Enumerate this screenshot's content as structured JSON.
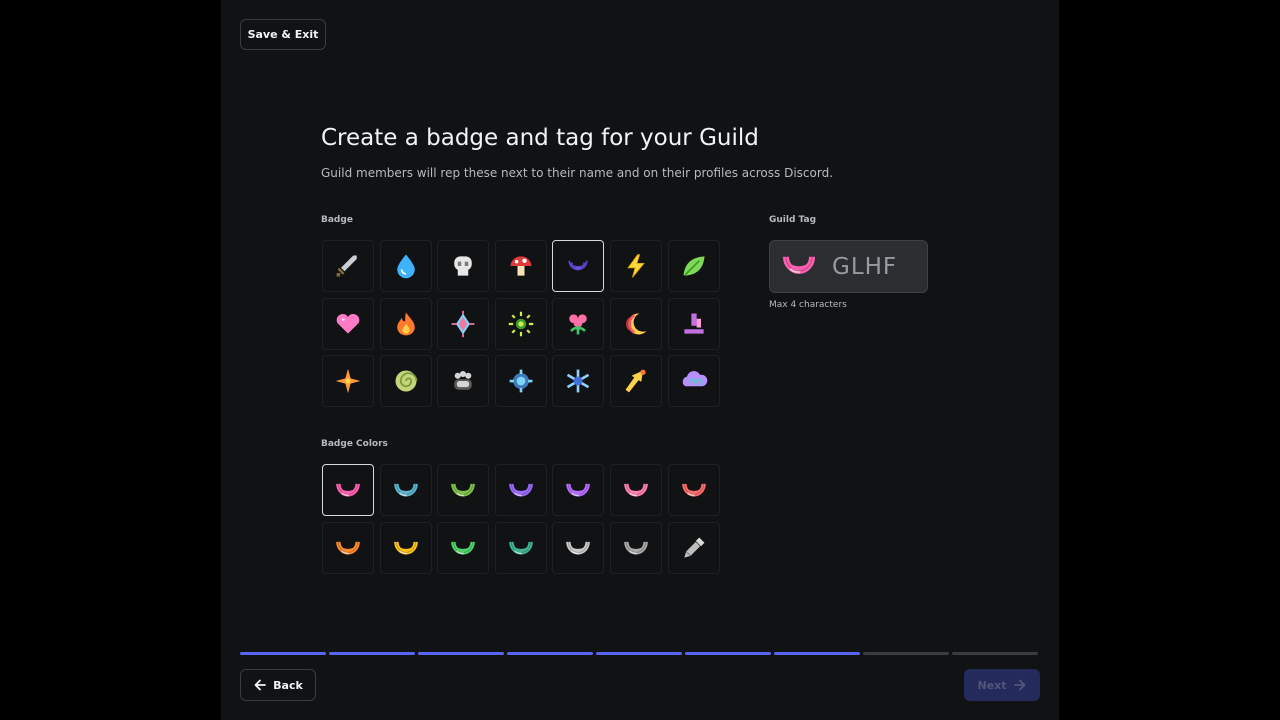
{
  "header": {
    "save_exit_label": "Save & Exit"
  },
  "page": {
    "title": "Create a badge and tag for your Guild",
    "subtitle": "Guild members will rep these next to their name and on their profiles across Discord."
  },
  "badge_section": {
    "label": "Badge",
    "selected_index": 4,
    "badges": [
      {
        "name": "sword",
        "colors": [
          "#c9cdd4",
          "#8a6a3c"
        ]
      },
      {
        "name": "water-drop",
        "colors": [
          "#3fb2ff",
          "#1d6fb8"
        ]
      },
      {
        "name": "skull",
        "colors": [
          "#e7e7e7",
          "#7a7a7a"
        ]
      },
      {
        "name": "mushroom",
        "colors": [
          "#e03b3b",
          "#f5e2b8"
        ]
      },
      {
        "name": "moon",
        "colors": [
          "#9b7bff",
          "#5a43c9"
        ]
      },
      {
        "name": "lightning",
        "colors": [
          "#ffd83b",
          "#e0a800"
        ]
      },
      {
        "name": "leaf",
        "colors": [
          "#7ed957",
          "#3f9a2c"
        ]
      },
      {
        "name": "heart",
        "colors": [
          "#ff7bc8",
          "#d93f8f"
        ]
      },
      {
        "name": "fire",
        "colors": [
          "#ff7a2f",
          "#ffd04a"
        ]
      },
      {
        "name": "sparkle-gem",
        "colors": [
          "#f07aa0",
          "#7fd3ff"
        ]
      },
      {
        "name": "sun",
        "colors": [
          "#c8f04a",
          "#3f9a2c"
        ]
      },
      {
        "name": "flower",
        "colors": [
          "#ff6fa8",
          "#3fc46a"
        ]
      },
      {
        "name": "crescent-stripes",
        "colors": [
          "#ff4f6f",
          "#ffd04a"
        ]
      },
      {
        "name": "crystal",
        "colors": [
          "#c36fe0",
          "#ff9fd8"
        ]
      },
      {
        "name": "compass-star",
        "colors": [
          "#ff9a3b",
          "#ffd04a"
        ]
      },
      {
        "name": "spiral-shell",
        "colors": [
          "#c3d47a",
          "#7a9a3c"
        ]
      },
      {
        "name": "paw",
        "colors": [
          "#d4d4d4",
          "#5a5a5a"
        ]
      },
      {
        "name": "gear-orb",
        "colors": [
          "#7fd3ff",
          "#3f7ab8"
        ]
      },
      {
        "name": "snowflake",
        "colors": [
          "#8fd0ff",
          "#3f6fd8"
        ]
      },
      {
        "name": "arrow-bolt",
        "colors": [
          "#ffd04a",
          "#ff7a2f"
        ]
      },
      {
        "name": "cloud-swirl",
        "colors": [
          "#b98fff",
          "#5fc4c4"
        ]
      }
    ]
  },
  "badge_colors_section": {
    "label": "Badge Colors",
    "selected_index": 0,
    "colors": [
      "#ff5fb0",
      "#5ab4cf",
      "#7fc24a",
      "#9b6bff",
      "#b86bff",
      "#ff7fb0",
      "#ff6b6b",
      "#ff8a2a",
      "#ffc31a",
      "#4fd46a",
      "#3fb58f",
      "#c9c9c9",
      "#a9a9a9",
      "custom"
    ],
    "custom_icon": "eyedropper-icon"
  },
  "guild_tag": {
    "label": "Guild Tag",
    "value": "GLHF",
    "badge_color": "#ff5fb0",
    "hint": "Max 4 characters"
  },
  "footer": {
    "back_label": "Back",
    "next_label": "Next",
    "progress_total": 9,
    "progress_done": 7
  },
  "colors": {
    "accent": "#5865f2",
    "panel_bg": "#111214"
  }
}
